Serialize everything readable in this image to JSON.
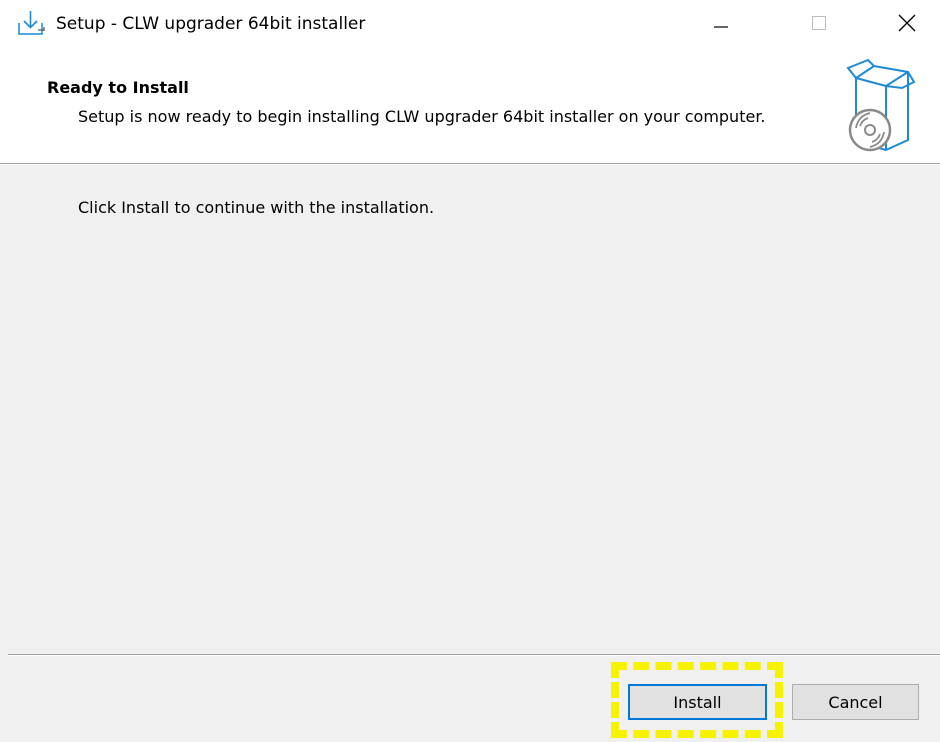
{
  "window": {
    "title": "Setup - CLW upgrader 64bit installer",
    "controls": {
      "minimize": "minimize",
      "maximize": "maximize",
      "close": "close"
    }
  },
  "header": {
    "title": "Ready to Install",
    "description": "Setup is now ready to begin installing CLW upgrader 64bit installer on your computer."
  },
  "body": {
    "instruction": "Click Install to continue with the installation."
  },
  "buttons": {
    "install_label": "Install",
    "cancel_label": "Cancel"
  },
  "icons": {
    "app": "installer-download-icon",
    "header_graphic": "software-box-cd-icon"
  },
  "colors": {
    "accent": "#0078d7",
    "highlight": "#f7f300",
    "panel_bg": "#f0f0f0",
    "header_bg": "#ffffff"
  }
}
